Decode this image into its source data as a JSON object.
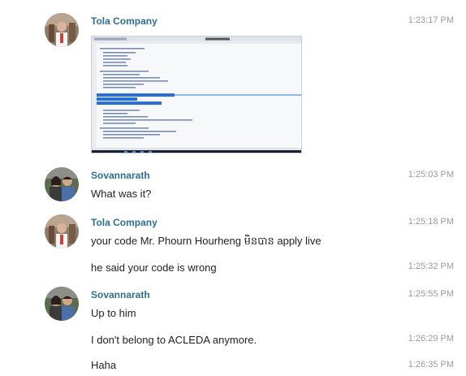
{
  "messages": [
    {
      "name": "Tola Company",
      "time": "1:23:17 PM"
    },
    {
      "name": "Sovannarath",
      "time": "1:25:03 PM",
      "text": "What was it?"
    },
    {
      "name": "Tola Company",
      "time": "1:25:18 PM",
      "text": "your code Mr. Phourn Hourheng មិនបាន apply live"
    },
    {
      "time": "1:25:32 PM",
      "text": "he said your code is wrong"
    },
    {
      "name": "Sovannarath",
      "time": "1:25:55 PM",
      "text": "Up to him"
    },
    {
      "time": "1:26:29 PM",
      "text": "I don't belong to ACLEDA anymore."
    },
    {
      "time": "1:26:35 PM",
      "text": "Haha"
    }
  ]
}
